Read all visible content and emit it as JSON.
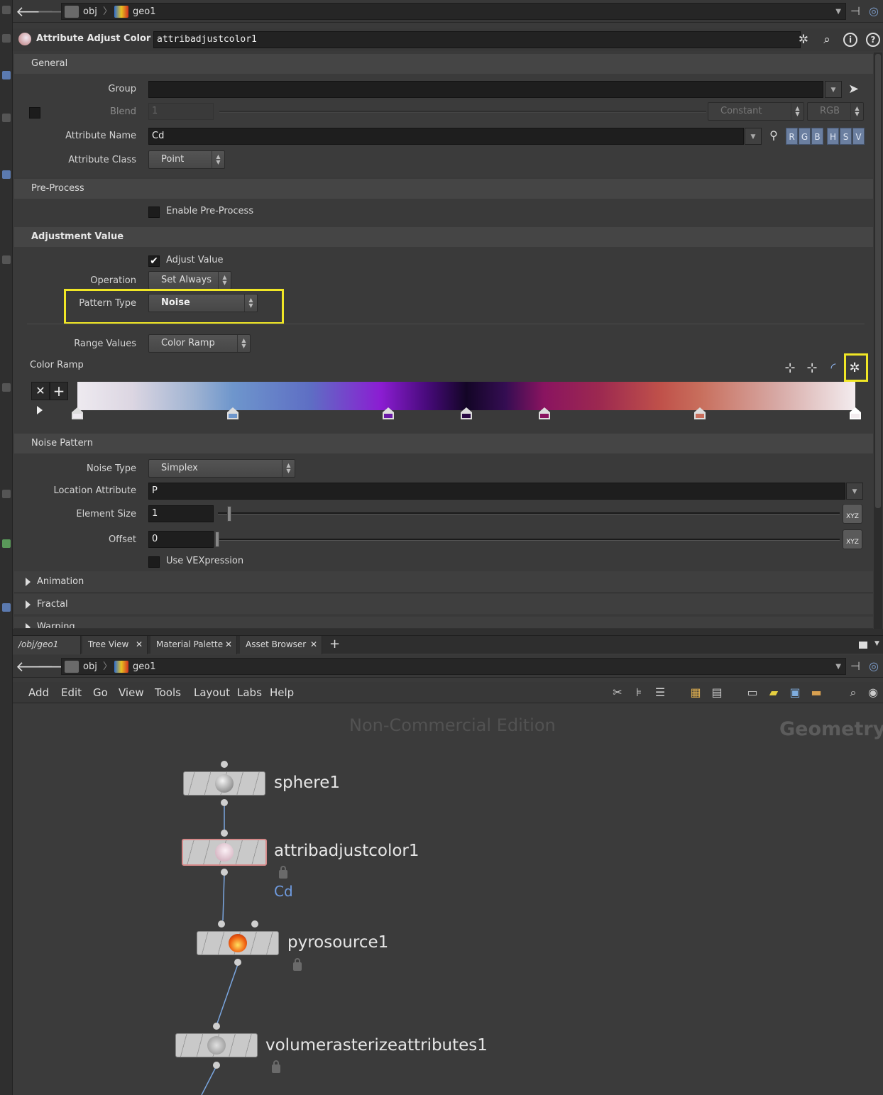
{
  "top_path": {
    "crumb_obj": "obj",
    "crumb_geo": "geo1"
  },
  "param_header": {
    "node_type": "Attribute Adjust Color",
    "node_name": "attribadjustcolor1"
  },
  "sections": {
    "general": "General",
    "preprocess": "Pre-Process",
    "adjustment": "Adjustment Value",
    "noise_pattern": "Noise Pattern"
  },
  "general": {
    "group_label": "Group",
    "group_value": "",
    "blend_label": "Blend",
    "blend_value": "1",
    "blend_mode": "Constant",
    "blend_space": "RGB",
    "attr_name_label": "Attribute Name",
    "attr_name_value": "Cd",
    "components": [
      "R",
      "G",
      "B",
      "H",
      "S",
      "V"
    ],
    "attr_class_label": "Attribute Class",
    "attr_class_value": "Point"
  },
  "preprocess": {
    "enable_label": "Enable Pre-Process"
  },
  "adjustment": {
    "adjust_value_label": "Adjust Value",
    "operation_label": "Operation",
    "operation_value": "Set Always",
    "pattern_type_label": "Pattern Type",
    "pattern_type_value": "Noise",
    "range_values_label": "Range Values",
    "range_values_value": "Color Ramp",
    "color_ramp_label": "Color Ramp"
  },
  "ramp_keys": [
    {
      "pos": 0.0,
      "color": "#eeeaf0"
    },
    {
      "pos": 0.2,
      "color": "#6e96cc"
    },
    {
      "pos": 0.4,
      "color": "#6a19a8"
    },
    {
      "pos": 0.5,
      "color": "#2a0a45"
    },
    {
      "pos": 0.6,
      "color": "#8a1460"
    },
    {
      "pos": 0.8,
      "color": "#c86e5c"
    },
    {
      "pos": 1.0,
      "color": "#f3ecef"
    }
  ],
  "noise": {
    "noise_type_label": "Noise Type",
    "noise_type_value": "Simplex",
    "location_label": "Location Attribute",
    "location_value": "P",
    "element_size_label": "Element Size",
    "element_size_value": "1",
    "offset_label": "Offset",
    "offset_value": "0",
    "vex_label": "Use VEXpression",
    "xyz": "XYZ"
  },
  "folders": [
    "Animation",
    "Fractal",
    "Warping"
  ],
  "tabs": [
    "/obj/geo1",
    "Tree View",
    "Material Palette",
    "Asset Browser"
  ],
  "bottom_path": {
    "crumb_obj": "obj",
    "crumb_geo": "geo1"
  },
  "menu": [
    "Add",
    "Edit",
    "Go",
    "View",
    "Tools",
    "Layout",
    "Labs",
    "Help"
  ],
  "network": {
    "watermark": "Non-Commercial Edition",
    "context": "Geometry",
    "nodes": [
      {
        "name": "sphere1"
      },
      {
        "name": "attribadjustcolor1",
        "flag": "Cd"
      },
      {
        "name": "pyrosource1"
      },
      {
        "name": "volumerasterizeattributes1"
      }
    ]
  },
  "colors": {
    "highlight": "#f0e626",
    "selected_node": "#d68a8a",
    "flag_text": "#6f9be0"
  }
}
